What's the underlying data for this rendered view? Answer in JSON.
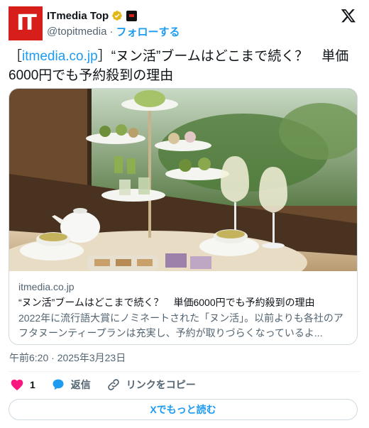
{
  "author": {
    "avatar_text": "IT",
    "display_name": "ITmedia Top",
    "handle": "@topitmedia",
    "separator": "·",
    "follow_label": "フォローする"
  },
  "tweet": {
    "bracket_open": "［",
    "link_text": "itmedia.co.jp",
    "text_rest": "］“ヌン活”ブームはどこまで続く？　単価6000円でも予約殺到の理由"
  },
  "card": {
    "image_alt": "afternoon tea stand with matcha sweets, champagne glasses and tea cups by a window",
    "domain": "itmedia.co.jp",
    "title": "“ヌン活”ブームはどこまで続く？　単価6000円でも予約殺到の理由",
    "description": "2022年に流行語大賞にノミネートされた「ヌン活」。以前よりも各社のアフタヌーンティープランは充実し、予約が取りづらくなっているよ..."
  },
  "timestamp": "午前6:20 · 2025年3月23日",
  "actions": {
    "like_count": "1",
    "reply_label": "返信",
    "copy_link_label": "リンクをコピー"
  },
  "read_more_label": "Xでもっと読む",
  "colors": {
    "brand_red": "#d71e1a",
    "link_blue": "#1d9bf0",
    "like_pink": "#f91880",
    "secondary_text": "#536471"
  }
}
